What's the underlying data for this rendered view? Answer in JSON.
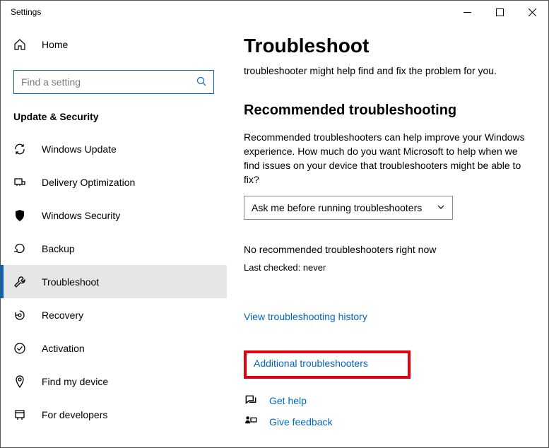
{
  "window": {
    "title": "Settings"
  },
  "sidebar": {
    "home": "Home",
    "search_placeholder": "Find a setting",
    "category": "Update & Security",
    "items": [
      {
        "label": "Windows Update"
      },
      {
        "label": "Delivery Optimization"
      },
      {
        "label": "Windows Security"
      },
      {
        "label": "Backup"
      },
      {
        "label": "Troubleshoot"
      },
      {
        "label": "Recovery"
      },
      {
        "label": "Activation"
      },
      {
        "label": "Find my device"
      },
      {
        "label": "For developers"
      }
    ]
  },
  "main": {
    "title": "Troubleshoot",
    "intro": "troubleshooter might help find and fix the problem for you.",
    "section_title": "Recommended troubleshooting",
    "section_body": "Recommended troubleshooters can help improve your Windows experience. How much do you want Microsoft to help when we find issues on your device that troubleshooters might be able to fix?",
    "dropdown_value": "Ask me before running troubleshooters",
    "no_recommended": "No recommended troubleshooters right now",
    "last_checked": "Last checked: never",
    "history_link": "View troubleshooting history",
    "additional_link": "Additional troubleshooters",
    "get_help": "Get help",
    "give_feedback": "Give feedback"
  }
}
